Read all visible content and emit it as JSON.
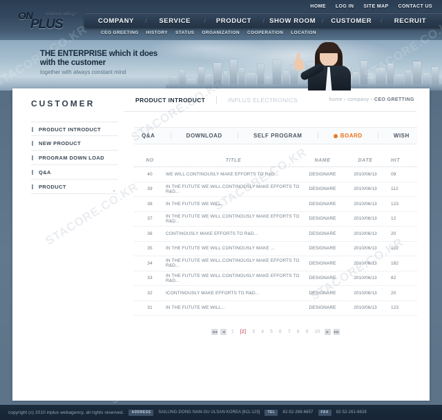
{
  "site": {
    "logo_main": "ON",
    "logo_sub": "PLUS",
    "logo_tagline": "creative design",
    "watermark": "STACORE.CO.KR"
  },
  "utility_nav": [
    {
      "label": "HOME"
    },
    {
      "label": "LOG IN"
    },
    {
      "label": "SITE MAP"
    },
    {
      "label": "CONTACT US"
    }
  ],
  "global_nav": [
    {
      "label": "COMPANY"
    },
    {
      "label": "SERVICE"
    },
    {
      "label": "PRODUCT"
    },
    {
      "label": "SHOW ROOM"
    },
    {
      "label": "CUSTOMER"
    },
    {
      "label": "RECRUIT"
    }
  ],
  "sub_nav": [
    {
      "label": "CEO GREETING"
    },
    {
      "label": "HISTORY"
    },
    {
      "label": "STATUS"
    },
    {
      "label": "ORGANIZATION"
    },
    {
      "label": "COOPERATION"
    },
    {
      "label": "LOCATION"
    }
  ],
  "banner": {
    "line1": "THE ENTERPRISE which it does",
    "line2": "with the customer",
    "subline": "together with always constant mind"
  },
  "content": {
    "page_title": "CUSTOMER",
    "tab_active": "PRODUCT INTRODUCT",
    "tab_inactive": "INPLUS ELECTRONICS",
    "breadcrumb": {
      "home": "home",
      "sep1": "›",
      "company": "company",
      "sep2": "›",
      "current": "CEO GRETTING"
    }
  },
  "left_nav": [
    {
      "label": "PRODUCT INTRODUCT",
      "arrow": ""
    },
    {
      "label": "NEW PRODUCT",
      "arrow": ""
    },
    {
      "label": "PROGRAM DOWN LOAD",
      "arrow": ""
    },
    {
      "label": "Q&A",
      "arrow": ""
    },
    {
      "label": "PRODUCT",
      "arrow": "»"
    }
  ],
  "sub_tabs": [
    {
      "label": "Q&A",
      "active": false
    },
    {
      "label": "DOWNLOAD",
      "active": false
    },
    {
      "label": "SELF PROGRAM",
      "active": false
    },
    {
      "label": "BOARD",
      "active": true
    },
    {
      "label": "WISH",
      "active": false
    }
  ],
  "board": {
    "columns": {
      "no": "NO",
      "title": "TITLE",
      "name": "NAME",
      "date": "DATE",
      "hit": "HIT"
    },
    "rows": [
      {
        "no": "40",
        "title": "WE WILL CONTINOUSLY MAKE EFFORTS TO R&D...",
        "name": "DESIGNARE",
        "date": "2010/06/13",
        "hit": "09"
      },
      {
        "no": "39",
        "title": "IN THE FUTUTE WE WILL CONTINOUSLY MAKE EFFORTS TO R&D...",
        "name": "DESIGNARE",
        "date": "2010/06/13",
        "hit": "112"
      },
      {
        "no": "38",
        "title": "IN THE FUTUTE WE WILL...",
        "name": "DESIGNARE",
        "date": "2010/06/13",
        "hit": "123"
      },
      {
        "no": "37",
        "title": "IN THE FUTUTE WE WILL CONTINOUSLY MAKE EFFORTS TO R&D...",
        "name": "DESIGNARE",
        "date": "2010/06/13",
        "hit": "12"
      },
      {
        "no": "36",
        "title": "CONTINOUSLY MAKE EFFORTS TO R&D...",
        "name": "DESIGNARE",
        "date": "2010/06/13",
        "hit": "20"
      },
      {
        "no": "35",
        "title": "IN THE FUTUTE WE WILL CONTINOUSLY MAKE ...",
        "name": "DESIGNARE",
        "date": "2010/06/13",
        "hit": "102"
      },
      {
        "no": "34",
        "title": "IN THE FUTUTE WE WILL CONTINOUSLY MAKE EFFORTS TO R&D...",
        "name": "DESIGNARE",
        "date": "2010/06/13",
        "hit": "182"
      },
      {
        "no": "33",
        "title": "IN THE FUTUTE WE WILL CONTINOUSLY MAKE EFFORTS TO R&D...",
        "name": "DESIGNARE",
        "date": "2010/06/13",
        "hit": "82"
      },
      {
        "no": "32",
        "title": "ICONTINOUSLY MAKE EFFORTS TO R&D...",
        "name": "DESIGNARE",
        "date": "2010/06/13",
        "hit": "20"
      },
      {
        "no": "31",
        "title": "IN THE FUTUTE WE WILL...",
        "name": "DESIGNARE",
        "date": "2010/06/13",
        "hit": "123"
      }
    ]
  },
  "pagination": {
    "first": "◀◀",
    "prev": "◀",
    "pages": [
      "1",
      "[2]",
      "3",
      "4",
      "5",
      "6",
      "7",
      "8",
      "9",
      "10"
    ],
    "current": "[2]",
    "next": "▶",
    "last": "▶▶"
  },
  "footer": {
    "copyright": "copyright (c) 2010 inplus webagency. all rights reserved.",
    "address_label": "ADDRESS",
    "address_value": "SAILUNG-DONG NAM-GU ULSAN KOREA  [611-123]",
    "tel_label": "TEL",
    "tel_value": "82-52-268-6657",
    "fax_label": "FAX",
    "fax_value": "82-52-261-6628"
  }
}
